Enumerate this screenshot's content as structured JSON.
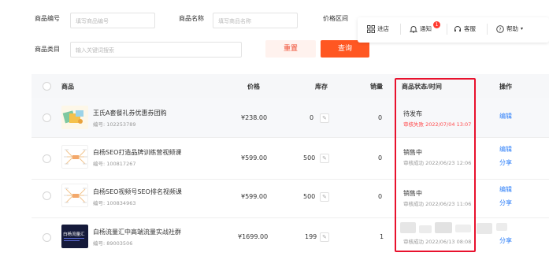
{
  "filters": {
    "code_label": "商品编号",
    "code_placeholder": "填写商品编号",
    "name_label": "商品名称",
    "name_placeholder": "填写商品名称",
    "price_label": "价格区间",
    "category_label": "商品类目",
    "category_placeholder": "输入关键词搜索",
    "reset_label": "重置",
    "query_label": "查询"
  },
  "toolbar": {
    "progress_label": "进店",
    "notify_label": "通知",
    "notify_count": "1",
    "service_label": "客服",
    "help_label": "帮助"
  },
  "table": {
    "headers": {
      "product": "商品",
      "price": "价格",
      "stock": "库存",
      "sales": "销量",
      "status": "商品状态/时间",
      "action": "操作"
    },
    "rows": [
      {
        "name": "王氏A套餐礼券优惠券团购",
        "code": "编号: 102253789",
        "price": "¥238.00",
        "stock": "0",
        "sales": "0",
        "status": "待发布",
        "status_time": "审核失败 2022/07/04 13:07",
        "status_time_color": "#ff4d4f",
        "actions": [
          "编辑"
        ]
      },
      {
        "name": "白杨SEO打造品牌训练营视频课",
        "code": "编号: 100817267",
        "price": "¥599.00",
        "stock": "500",
        "sales": "0",
        "status": "销售中",
        "status_time": "审核成功 2022/06/23 12:06",
        "status_time_color": "#999999",
        "actions": [
          "编辑",
          "分享"
        ]
      },
      {
        "name": "白杨SEO视频号SEO排名视频课",
        "code": "编号: 100834963",
        "price": "¥599.00",
        "stock": "500",
        "sales": "0",
        "status": "销售中",
        "status_time": "审核成功 2022/06/23 11:06",
        "status_time_color": "#999999",
        "actions": [
          "编辑",
          "分享"
        ]
      },
      {
        "name": "白杨流量汇中高端流量实战社群",
        "code": "编号: 89003506",
        "thumb_text": "白杨流量汇",
        "price": "¥1699.00",
        "stock": "199",
        "sales": "1",
        "status": "",
        "status_time": "审核成功 2022/06/13 08:08",
        "status_time_color": "#999999",
        "actions": [
          "分享"
        ]
      }
    ],
    "stock_edit_icon": "pencil-icon"
  },
  "colors": {
    "accent": "#ff5722",
    "link": "#2d7ff9",
    "highlight_box": "#e8112d"
  }
}
